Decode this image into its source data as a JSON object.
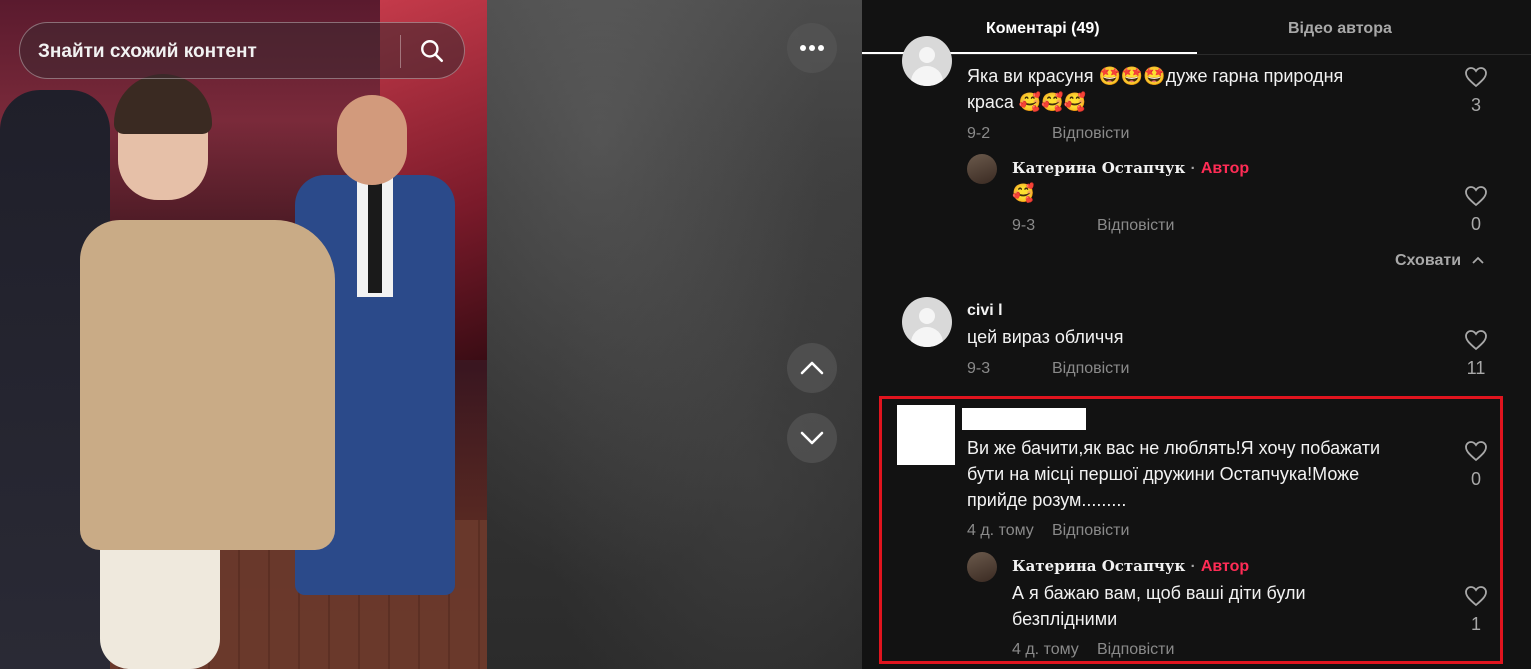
{
  "search": {
    "placeholder_text": "Знайти схожий контент"
  },
  "tabs": [
    {
      "label": "Коментарі (49)"
    },
    {
      "label": "Відео автора"
    }
  ],
  "comments": [
    {
      "text_line1": "Яка ви красуня 🤩🤩🤩дуже гарна природня",
      "text_line2": "краса 🥰🥰🥰",
      "date": "9-2",
      "reply_label": "Відповісти",
      "likes": "3",
      "replies": [
        {
          "author": "Катерина Остапчук",
          "separator": "·",
          "badge": "Автор",
          "text": "🥰",
          "date": "9-3",
          "reply_label": "Відповісти",
          "likes": "0"
        }
      ],
      "hide_label": "Сховати"
    },
    {
      "username": "civi l",
      "text": "цей вираз обличчя",
      "date": "9-3",
      "reply_label": "Відповісти",
      "likes": "11"
    },
    {
      "text_line1": "Ви же бачити,як вас не люблять!Я хочу побажати",
      "text_line2": "бути на місці першої дружини Остапчука!Може",
      "text_line3": "прийде розум.........",
      "date": "4 д. тому",
      "reply_label": "Відповісти",
      "likes": "0",
      "replies": [
        {
          "author": "Катерина Остапчук",
          "separator": "·",
          "badge": "Автор",
          "text_line1": "А я бажаю вам, щоб ваші діти були",
          "text_line2": "безплідними",
          "date": "4 д. тому",
          "reply_label": "Відповісти",
          "likes": "1"
        }
      ]
    }
  ],
  "colors": {
    "author_badge": "#fe2c55",
    "highlight_border": "#e0141e",
    "panel_bg": "#121212"
  }
}
